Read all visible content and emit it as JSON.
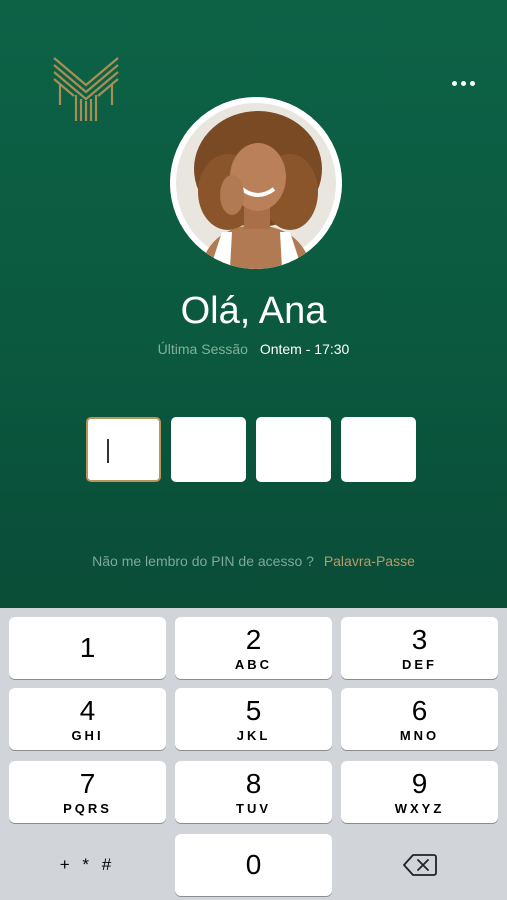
{
  "header": {
    "logo": "bank-logo",
    "menu_icon": "more-dots-icon"
  },
  "profile": {
    "greeting": "Olá, Ana",
    "last_session_label": "Última Sessão",
    "last_session_value": "Ontem - 17:30"
  },
  "pin": {
    "length": 4,
    "filled": 0
  },
  "forgot": {
    "question": "Não me lembro do PIN de acesso ?",
    "link": "Palavra-Passe"
  },
  "keypad": {
    "keys": [
      {
        "num": "1",
        "letters": ""
      },
      {
        "num": "2",
        "letters": "ABC"
      },
      {
        "num": "3",
        "letters": "DEF"
      },
      {
        "num": "4",
        "letters": "GHI"
      },
      {
        "num": "5",
        "letters": "JKL"
      },
      {
        "num": "6",
        "letters": "MNO"
      },
      {
        "num": "7",
        "letters": "PQRS"
      },
      {
        "num": "8",
        "letters": "TUV"
      },
      {
        "num": "9",
        "letters": "WXYZ"
      }
    ],
    "symbols": "+ * #",
    "zero": "0",
    "delete_icon": "backspace-icon"
  },
  "colors": {
    "background": "#0b5a40",
    "accent": "#b89a6a",
    "keyboard": "#d1d4d8"
  }
}
